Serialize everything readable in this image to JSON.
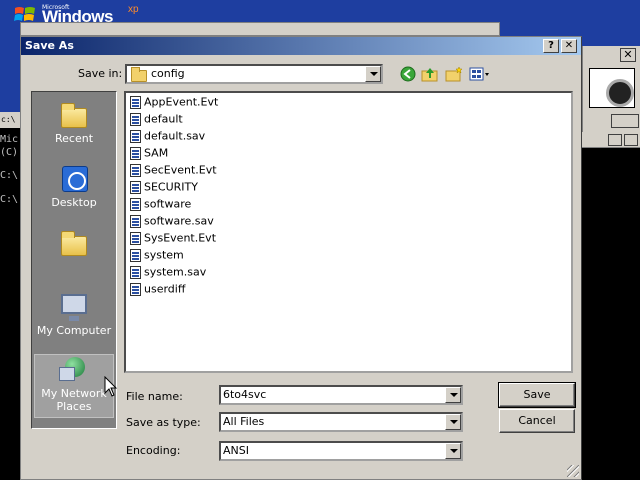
{
  "desktop": {
    "logo_small": "Microsoft",
    "logo_main": "Windows",
    "logo_xp": "xp",
    "console_lines": [
      "Mic",
      "(C)",
      "C:\\",
      "C:\\"
    ],
    "console_title": "c:\\"
  },
  "dialog": {
    "title": "Save As",
    "help_button": "?",
    "close_button": "✕",
    "save_in_label": "Save in:",
    "save_in_value": "config",
    "toolbar_icons": [
      "back-icon",
      "up-folder-icon",
      "new-folder-icon",
      "view-menu-icon"
    ],
    "places": [
      {
        "label": "Recent",
        "icon": "recent-folder-icon"
      },
      {
        "label": "Desktop",
        "icon": "desktop-icon"
      },
      {
        "label": "",
        "icon": "folder-icon"
      },
      {
        "label": "My Computer",
        "icon": "my-computer-icon"
      },
      {
        "label": "My Network Places",
        "icon": "network-places-icon"
      }
    ],
    "files": [
      "AppEvent.Evt",
      "default",
      "default.sav",
      "SAM",
      "SecEvent.Evt",
      "SECURITY",
      "software",
      "software.sav",
      "SysEvent.Evt",
      "system",
      "system.sav",
      "userdiff"
    ],
    "file_name_label": "File name:",
    "file_name_value": "6to4svc",
    "save_as_type_label": "Save as type:",
    "save_as_type_value": "All Files",
    "encoding_label": "Encoding:",
    "encoding_value": "ANSI",
    "save_button": "Save",
    "cancel_button": "Cancel"
  }
}
